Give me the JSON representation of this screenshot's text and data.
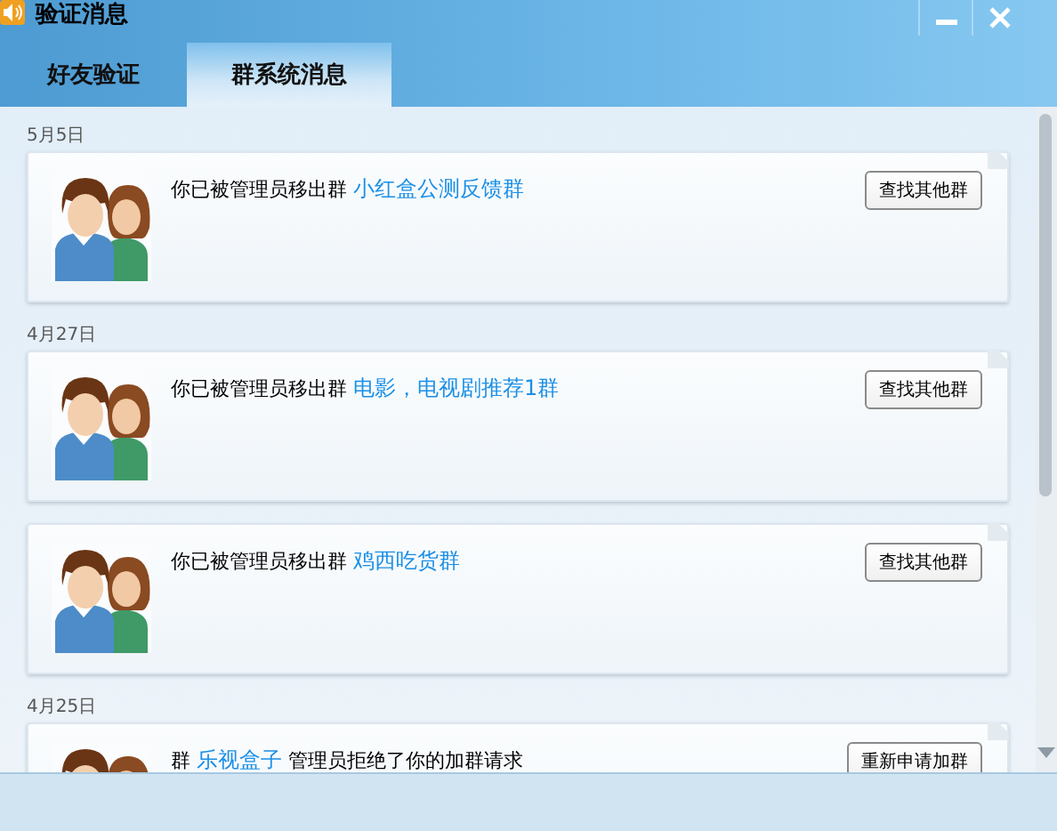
{
  "window": {
    "title": "验证消息"
  },
  "tabs": [
    {
      "label": "好友验证",
      "selected": false
    },
    {
      "label": "群系统消息",
      "selected": true
    }
  ],
  "groups": [
    {
      "date": "5月5日",
      "items": [
        {
          "prefix": "你已被管理员移出群",
          "group": "小红盒公测反馈群",
          "button": "查找其他群"
        }
      ]
    },
    {
      "date": "4月27日",
      "items": [
        {
          "prefix": "你已被管理员移出群",
          "group": "电影，电视剧推荐1群",
          "button": "查找其他群"
        },
        {
          "prefix": "你已被管理员移出群",
          "group": "鸡西吃货群",
          "button": "查找其他群"
        }
      ]
    },
    {
      "date": "4月25日",
      "items": [
        {
          "prefix": "群",
          "group": "乐视盒子",
          "suffix": "管理员拒绝了你的加群请求",
          "button": "重新申请加群"
        }
      ]
    }
  ]
}
